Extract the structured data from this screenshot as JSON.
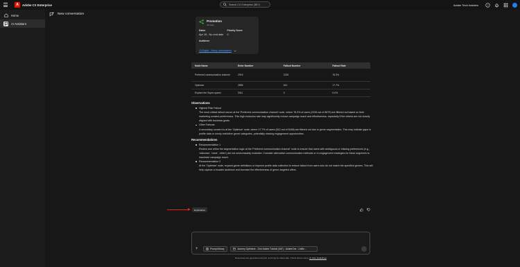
{
  "app": {
    "brand": "Adobe CX Enterprise",
    "logo_letter": "A",
    "org": "Adobe Tech Insiders"
  },
  "search": {
    "placeholder": "Search CX Enterprise (⌘+/)"
  },
  "sidebar": {
    "items": [
      {
        "label": "Home",
        "icon": "home-icon"
      },
      {
        "label": "AI Assistant",
        "icon": "ai-assistant-icon"
      }
    ]
  },
  "conversation": {
    "title": "New conversation"
  },
  "card": {
    "title": "Promotion",
    "subtitle": "Journey",
    "dates_label": "Dates",
    "dates_value": "Apr 15 - No end date",
    "priority_label": "Priority Score",
    "priority_value": "0",
    "audience_label": "Audience",
    "audience_value": "CKDigital - Heavy downloaders"
  },
  "table": {
    "headers": [
      "Node Name",
      "Enter Number",
      "Fallout Number",
      "Fallout Rate"
    ],
    "rows": [
      [
        "Preferred communication channel",
        "2919",
        "2226",
        "76.3%"
      ],
      [
        "Optimize",
        "2895",
        "512",
        "17.7%"
      ],
      [
        "Explore the Super-speed",
        "3311",
        "0",
        "0.0%"
      ]
    ]
  },
  "observations": {
    "heading": "Observations",
    "items": [
      {
        "title": "Highest Risk Fallout",
        "text": "The most critical fallout occurs at the 'Preferred communication channel' node, where 76.3% of users (2226 out of 8679) are filtered out based on their marketing consent preferences. This high exclusion rate may significantly reduce campaign reach and effectiveness, especially if the criteria are not closely aligned with business goals."
      },
      {
        "title": "Other Fallouts",
        "text": "A secondary concern is at the 'Optimize' node, where 17.7% of users (512 out of 5448) are filtered out due to genre segmentation. This may indicate gaps in profile data or overly restrictive genre categories, potentially missing engagement opportunities."
      }
    ]
  },
  "recommendations": {
    "heading": "Recommendations",
    "items": [
      {
        "title": "Recommendation 1",
        "text": "Review and refine the segmentation logic at the 'Preferred communication channel' node to ensure that users with ambiguous or missing preferences (e.g., 'unknown', 'none', 'other') are not unnecessarily excluded. Consider alternative communication methods or re-engagement strategies for these segments to maximize campaign reach."
      },
      {
        "title": "Recommendation 2",
        "text": "At the 'Optimize' node, expand genre definitions or improve profile data collection to reduce fallout from users who do not match the specified genres. This will help capture a broader audience and increase the effectiveness of genre-targeted offers."
      }
    ]
  },
  "explanation_label": "Explanation",
  "composer": {
    "prompt_library": "Prompt library",
    "context": "Journey Optimizer - One Adobe Tutorial (VAT) - AdobeOne - Unifie..."
  },
  "disclaimer": {
    "text": "Responses are generated using AI, and may be inaccurate. Check before using.",
    "link": "AI User Guidelines"
  },
  "colors": {
    "accent_red": "#eb1000",
    "link_blue": "#4b9cf5",
    "avatar_blue": "#2680eb"
  }
}
